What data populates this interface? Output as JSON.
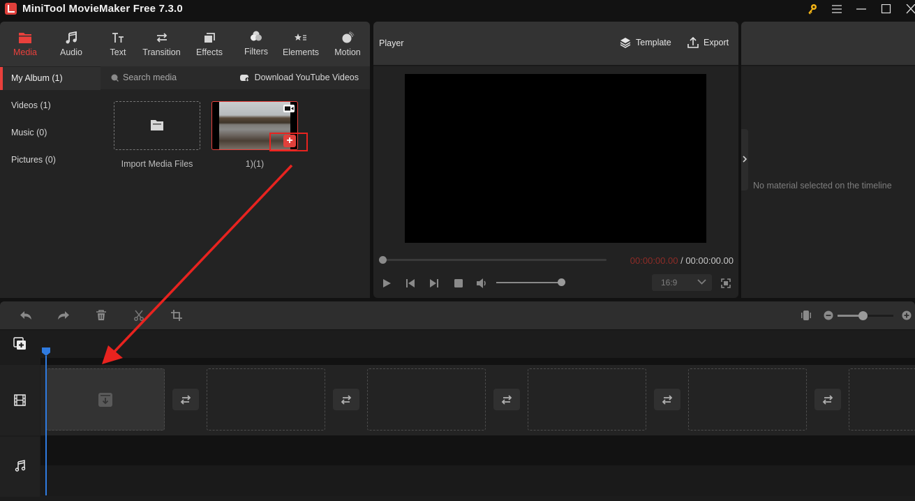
{
  "window": {
    "title": "MiniTool MovieMaker Free 7.3.0",
    "controls": [
      "key-icon",
      "menu-icon",
      "minimize-icon",
      "maximize-icon",
      "close-icon"
    ]
  },
  "toolbar": {
    "tabs": [
      {
        "label": "Media",
        "icon": "folder-icon",
        "active": true
      },
      {
        "label": "Audio",
        "icon": "music-icon",
        "active": false
      },
      {
        "label": "Text",
        "icon": "text-icon",
        "active": false
      },
      {
        "label": "Transition",
        "icon": "transition-icon",
        "active": false
      },
      {
        "label": "Effects",
        "icon": "effects-icon",
        "active": false
      },
      {
        "label": "Filters",
        "icon": "filters-icon",
        "active": false
      },
      {
        "label": "Elements",
        "icon": "elements-icon",
        "active": false
      },
      {
        "label": "Motion",
        "icon": "motion-icon",
        "active": false
      }
    ],
    "accent_color": "#e9403c"
  },
  "sidebar": {
    "items": [
      {
        "label": "My Album (1)",
        "active": true
      },
      {
        "label": "Videos (1)",
        "active": false
      },
      {
        "label": "Music (0)",
        "active": false
      },
      {
        "label": "Pictures (0)",
        "active": false
      }
    ]
  },
  "media": {
    "search_placeholder": "Search media",
    "download_label": "Download YouTube Videos",
    "import_label": "Import Media Files",
    "items": [
      {
        "name": "1)(1)",
        "type": "video",
        "add_label": "+"
      }
    ]
  },
  "player": {
    "title": "Player",
    "template_label": "Template",
    "export_label": "Export",
    "current_time": "00:00:00.00",
    "separator": " / ",
    "total_time": "00:00:00.00",
    "aspect_ratio": "16:9",
    "seek_progress": 0,
    "volume": 1.0
  },
  "properties": {
    "empty_message": "No material selected on the timeline"
  },
  "timeline": {
    "tools": [
      "undo-icon",
      "redo-icon",
      "delete-icon",
      "split-icon",
      "crop-icon"
    ],
    "zoom_level": 0.45,
    "playhead_color": "#2f7be0",
    "video_slots": 6,
    "transitions": 5
  },
  "annotation": {
    "arrow_color": "#e8231f"
  }
}
